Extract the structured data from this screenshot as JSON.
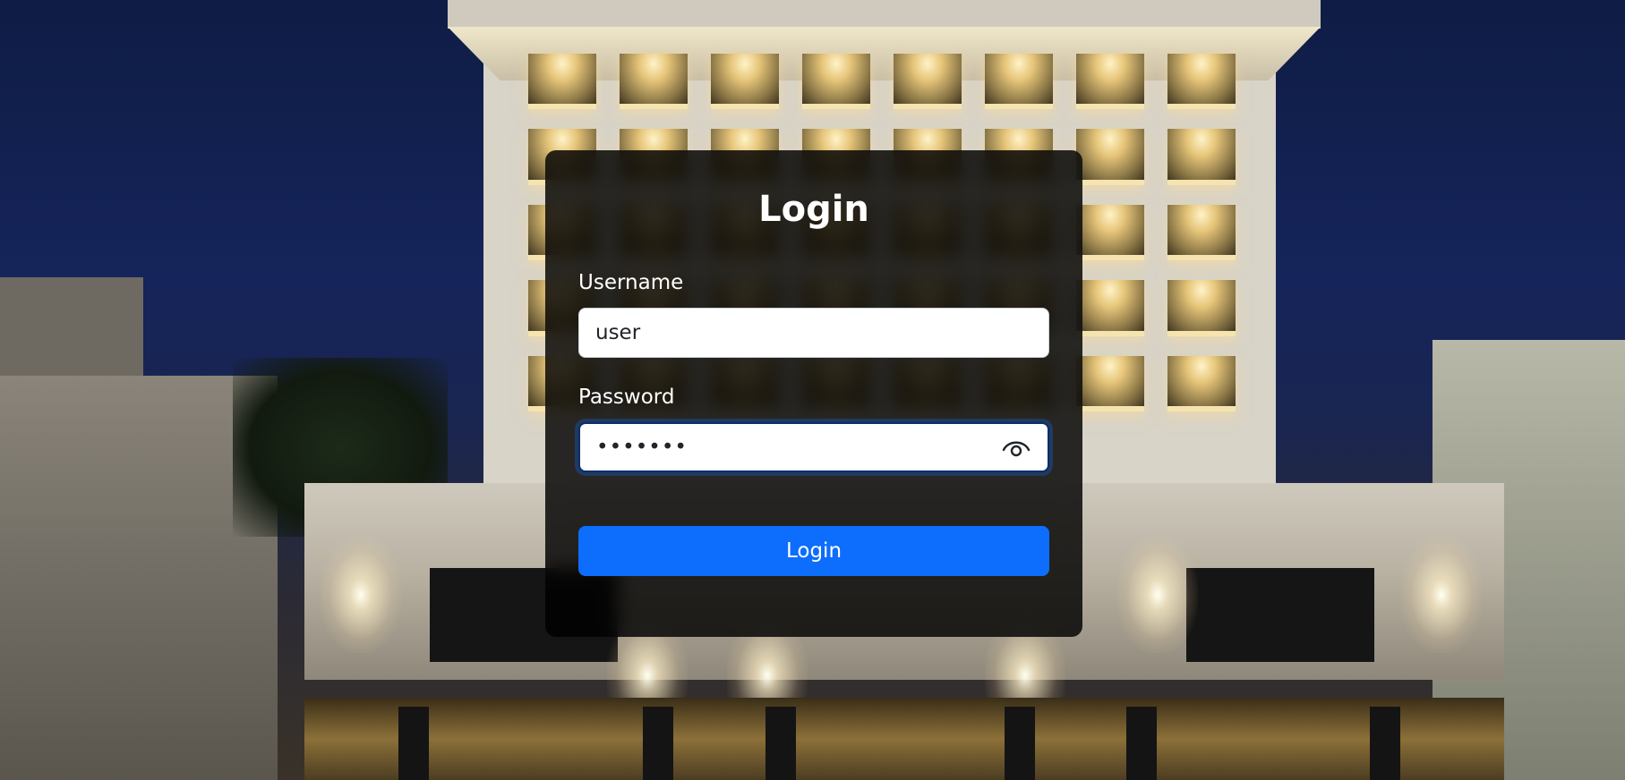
{
  "login_form": {
    "title": "Login",
    "username": {
      "label": "Username",
      "value": "user",
      "placeholder": ""
    },
    "password": {
      "label": "Password",
      "value": "•••••••",
      "show_password_icon": "eye-icon"
    },
    "submit_label": "Login"
  },
  "colors": {
    "primary_button": "#0d6efd",
    "card_background": "#000000",
    "focus_border": "#0b2d6b"
  }
}
